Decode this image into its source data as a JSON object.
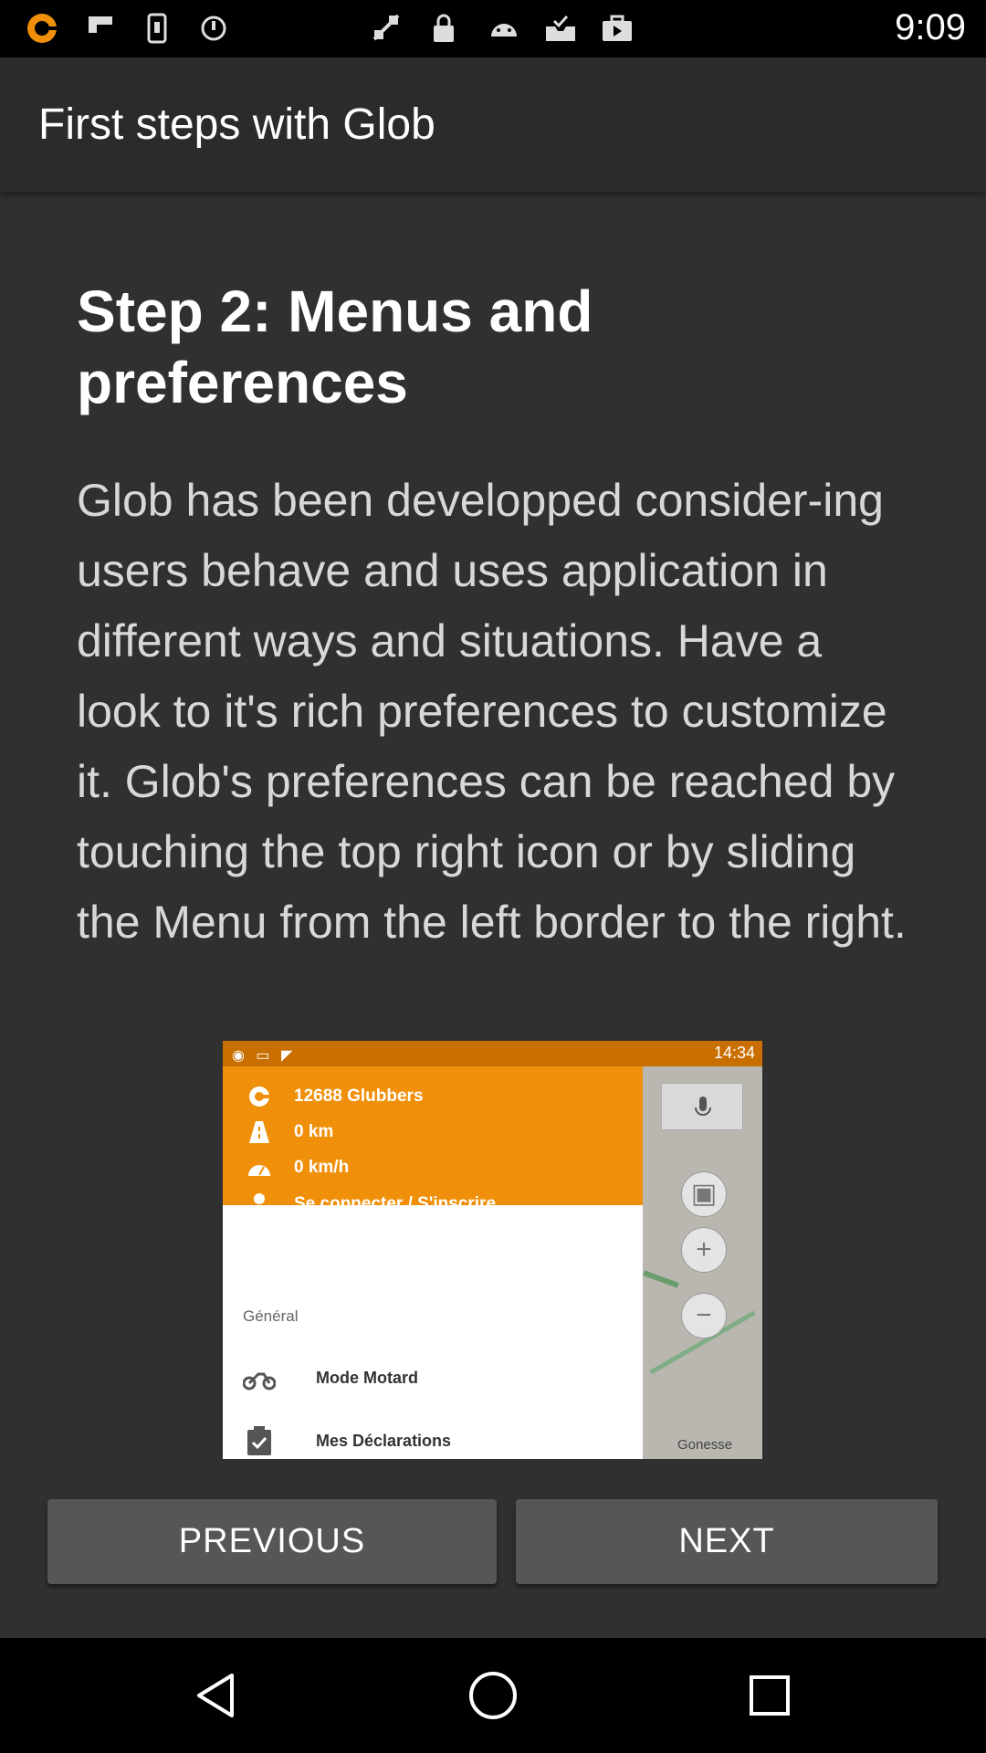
{
  "status_bar": {
    "time": "9:09",
    "icons": [
      "glob-app-icon",
      "flipboard-icon",
      "phone-settings-icon",
      "sync-icon",
      "fake-gps-icon",
      "lock-icon",
      "android-icon",
      "inbox-check-icon",
      "briefcase-icon"
    ]
  },
  "app_bar": {
    "title": "First steps with Glob"
  },
  "step": {
    "title": "Step 2: Menus and preferences",
    "body": "Glob has been developped consider-ing users behave and uses application in different ways and situations. Have a look to it's rich preferences to customize it. Glob's preferences can be reached by touching the top right icon or by sliding the Menu from the left border to the right."
  },
  "preview": {
    "status_time": "14:34",
    "header_rows": [
      {
        "icon": "glob-logo-icon",
        "label": "12688 Glubbers"
      },
      {
        "icon": "road-icon",
        "label": "0 km"
      },
      {
        "icon": "speedometer-icon",
        "label": "0 km/h"
      },
      {
        "icon": "user-icon",
        "label": "Se connecter / S'inscrire"
      }
    ],
    "section_label": "Général",
    "items": [
      {
        "icon": "motorbike-icon",
        "label": "Mode Motard"
      },
      {
        "icon": "clipboard-check-icon",
        "label": "Mes Déclarations"
      }
    ],
    "map_label": "Gonesse"
  },
  "buttons": {
    "previous": "PREVIOUS",
    "next": "NEXT"
  },
  "nav": {
    "back": "back-icon",
    "home": "home-icon",
    "recents": "recents-icon"
  },
  "colors": {
    "accent": "#f0900a",
    "app_bar": "#2b2b2b",
    "background": "#303030",
    "button": "#565656"
  }
}
